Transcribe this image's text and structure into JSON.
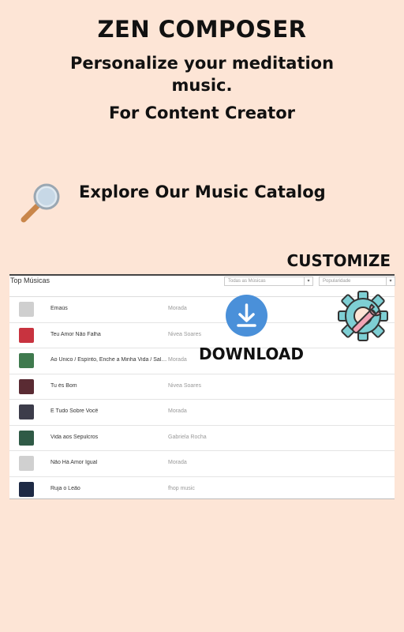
{
  "header": {
    "title": "ZEN COMPOSER",
    "subtitle": "Personalize your meditation music.",
    "subtitle2": "For Content Creator"
  },
  "explore": {
    "label": "Explore Our Music Catalog",
    "icon": "magnifier-icon"
  },
  "customize": {
    "label": "CUSTOMIZE",
    "icon": "gear-wrench-icon"
  },
  "download": {
    "label": "DOWNLOAD",
    "icon": "download-icon",
    "color": "#4a90d9"
  },
  "catalog": {
    "title": "Top Músicas",
    "filter_select": "Todas as Músicas",
    "sort_select": "Popularidade",
    "rows": [
      {
        "track": "Emaús",
        "artist": "Morada",
        "thumb_color": "#cfcfcf"
      },
      {
        "track": "Teu Amor Não Falha",
        "artist": "Nivea Soares",
        "thumb_color": "#c8333f"
      },
      {
        "track": "Ao Único / Espírito, Enche a Minha Vida / Sala ...",
        "artist": "Morada",
        "thumb_color": "#3f7a4e"
      },
      {
        "track": "Tu és Bom",
        "artist": "Nivea Soares",
        "thumb_color": "#5a2b33"
      },
      {
        "track": "É Tudo Sobre Você",
        "artist": "Morada",
        "thumb_color": "#3c3c4a"
      },
      {
        "track": "Vida aos Sepulcros",
        "artist": "Gabriela Rocha",
        "thumb_color": "#2f5a46"
      },
      {
        "track": "Não Há Amor Igual",
        "artist": "Morada",
        "thumb_color": "#d0d0d0"
      },
      {
        "track": "Ruja o Leão",
        "artist": "fhop music",
        "thumb_color": "#1e2a45"
      }
    ]
  }
}
